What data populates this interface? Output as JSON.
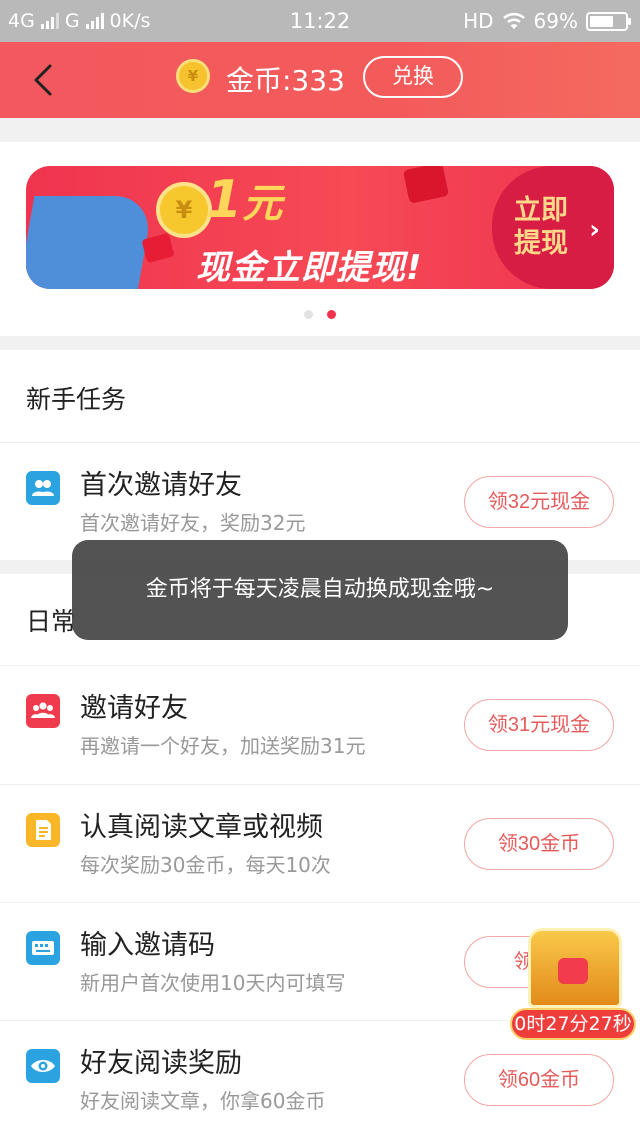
{
  "status_bar": {
    "network1": "4G",
    "network2": "G",
    "speed": "0K/s",
    "time": "11:22",
    "hd": "HD",
    "battery": "69%",
    "battery_level": 0.69
  },
  "header": {
    "coin_symbol": "¥",
    "coins": "金币:333",
    "exchange_label": "兑换"
  },
  "banner": {
    "amount": "1",
    "unit": "元",
    "subtitle": "现金立即提现!",
    "cta_line1": "立即",
    "cta_line2": "提现",
    "cta_chevron": "›",
    "coin_symbol": "¥",
    "active_dot": 2,
    "dot_count": 2
  },
  "newbie": {
    "title": "新手任务",
    "tasks": [
      {
        "name": "首次邀请好友",
        "desc": "首次邀请好友，奖励32元",
        "button": "领32元现金",
        "icon": "users-icon",
        "color": "#2aa3e0"
      }
    ]
  },
  "daily": {
    "title": "日常",
    "tasks": [
      {
        "name": "邀请好友",
        "desc": "再邀请一个好友，加送奖励31元",
        "button": "领31元现金",
        "icon": "group-icon",
        "color": "#ef3b4d"
      },
      {
        "name": "认真阅读文章或视频",
        "desc": "每次奖励30金币，每天10次",
        "button": "领30金币",
        "icon": "document-icon",
        "color": "#f8b628"
      },
      {
        "name": "输入邀请码",
        "desc": "新用户首次使用10天内可填写",
        "button": "领1元",
        "icon": "keyboard-icon",
        "color": "#2aa3e0"
      },
      {
        "name": "好友阅读奖励",
        "desc": "好友阅读文章，你拿60金币",
        "button": "领60金币",
        "icon": "eye-icon",
        "color": "#2aa3e0"
      }
    ]
  },
  "toast": "金币将于每天凌晨自动换成现金哦~",
  "treasure": {
    "timer": "0时27分27秒"
  }
}
